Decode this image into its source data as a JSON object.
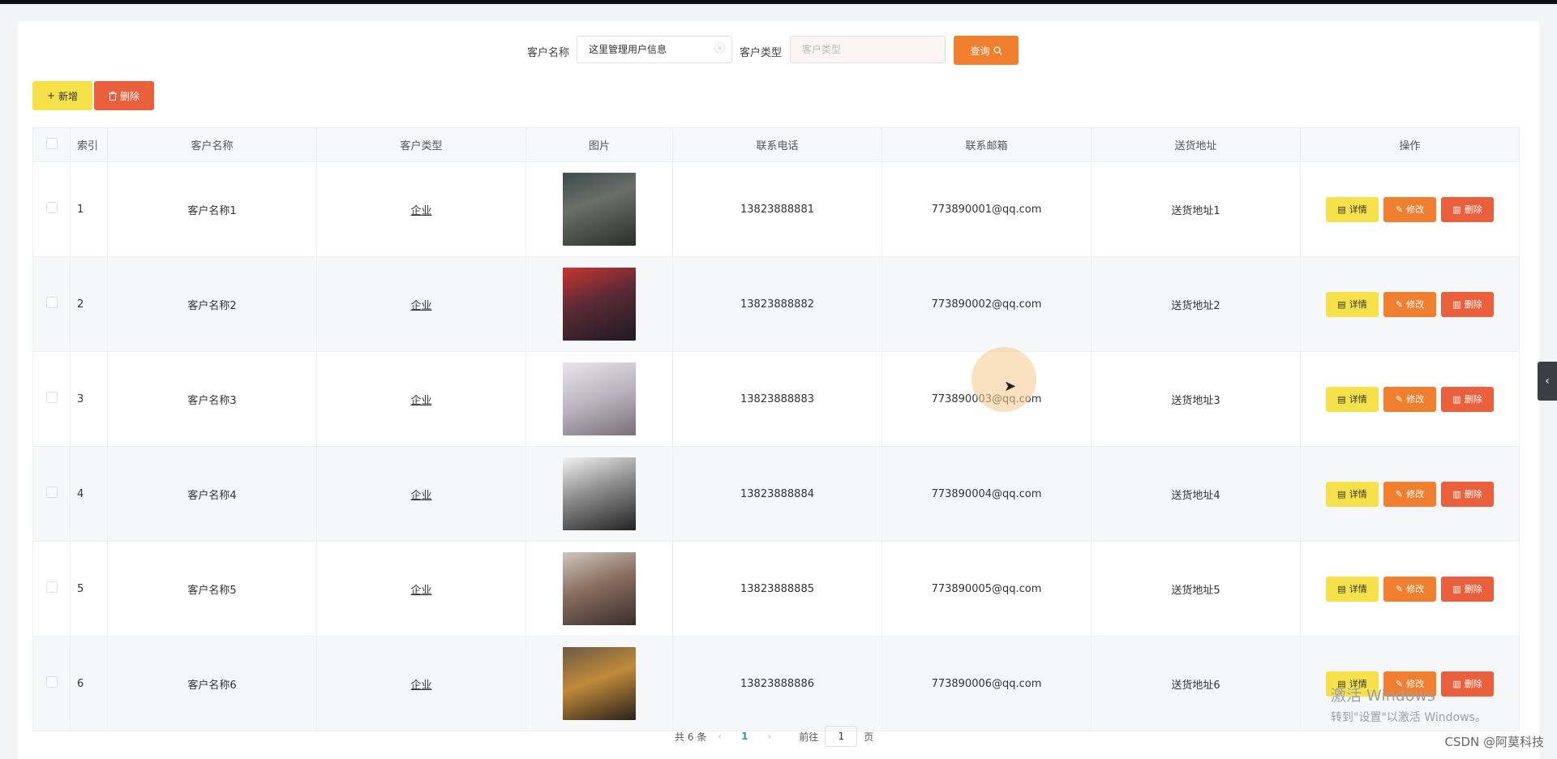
{
  "search": {
    "name_label": "客户名称",
    "name_value": "这里管理用户信息",
    "type_label": "客户类型",
    "type_placeholder": "客户类型",
    "query_label": "查询"
  },
  "toolbar": {
    "add_label": "新增",
    "delete_label": "删除"
  },
  "table": {
    "headers": [
      "索引",
      "客户名称",
      "客户类型",
      "图片",
      "联系电话",
      "联系邮箱",
      "送货地址",
      "操作"
    ],
    "rows": [
      {
        "index": "1",
        "name": "客户名称1",
        "type": "企业",
        "phone": "13823888881",
        "email": "773890001@qq.com",
        "address": "送货地址1"
      },
      {
        "index": "2",
        "name": "客户名称2",
        "type": "企业",
        "phone": "13823888882",
        "email": "773890002@qq.com",
        "address": "送货地址2"
      },
      {
        "index": "3",
        "name": "客户名称3",
        "type": "企业",
        "phone": "13823888883",
        "email": "773890003@qq.com",
        "address": "送货地址3"
      },
      {
        "index": "4",
        "name": "客户名称4",
        "type": "企业",
        "phone": "13823888884",
        "email": "773890004@qq.com",
        "address": "送货地址4"
      },
      {
        "index": "5",
        "name": "客户名称5",
        "type": "企业",
        "phone": "13823888885",
        "email": "773890005@qq.com",
        "address": "送货地址5"
      },
      {
        "index": "6",
        "name": "客户名称6",
        "type": "企业",
        "phone": "13823888886",
        "email": "773890006@qq.com",
        "address": "送货地址6"
      }
    ],
    "row_actions": {
      "detail": "详情",
      "edit": "修改",
      "delete": "删除"
    }
  },
  "pagination": {
    "total_text": "共 6 条",
    "current_page": "1",
    "goto_label": "前往",
    "goto_value": "1",
    "page_suffix": "页"
  },
  "watermark": {
    "line1": "激活 Windows",
    "line2": "转到\"设置\"以激活 Windows。"
  },
  "credit": "CSDN @阿莫科技",
  "colors": {
    "accent_orange": "#f08030",
    "accent_yellow": "#f6e14a",
    "danger_red": "#ea5f3c",
    "pager_active": "#1fa09a"
  },
  "icons": {
    "query": "search-icon",
    "add": "plus-icon",
    "delete": "trash-icon",
    "detail": "document-icon",
    "edit": "pencil-icon",
    "clear": "circle-x-icon",
    "prev": "chevron-left-icon",
    "next": "chevron-right-icon",
    "side": "chevron-left-icon"
  }
}
